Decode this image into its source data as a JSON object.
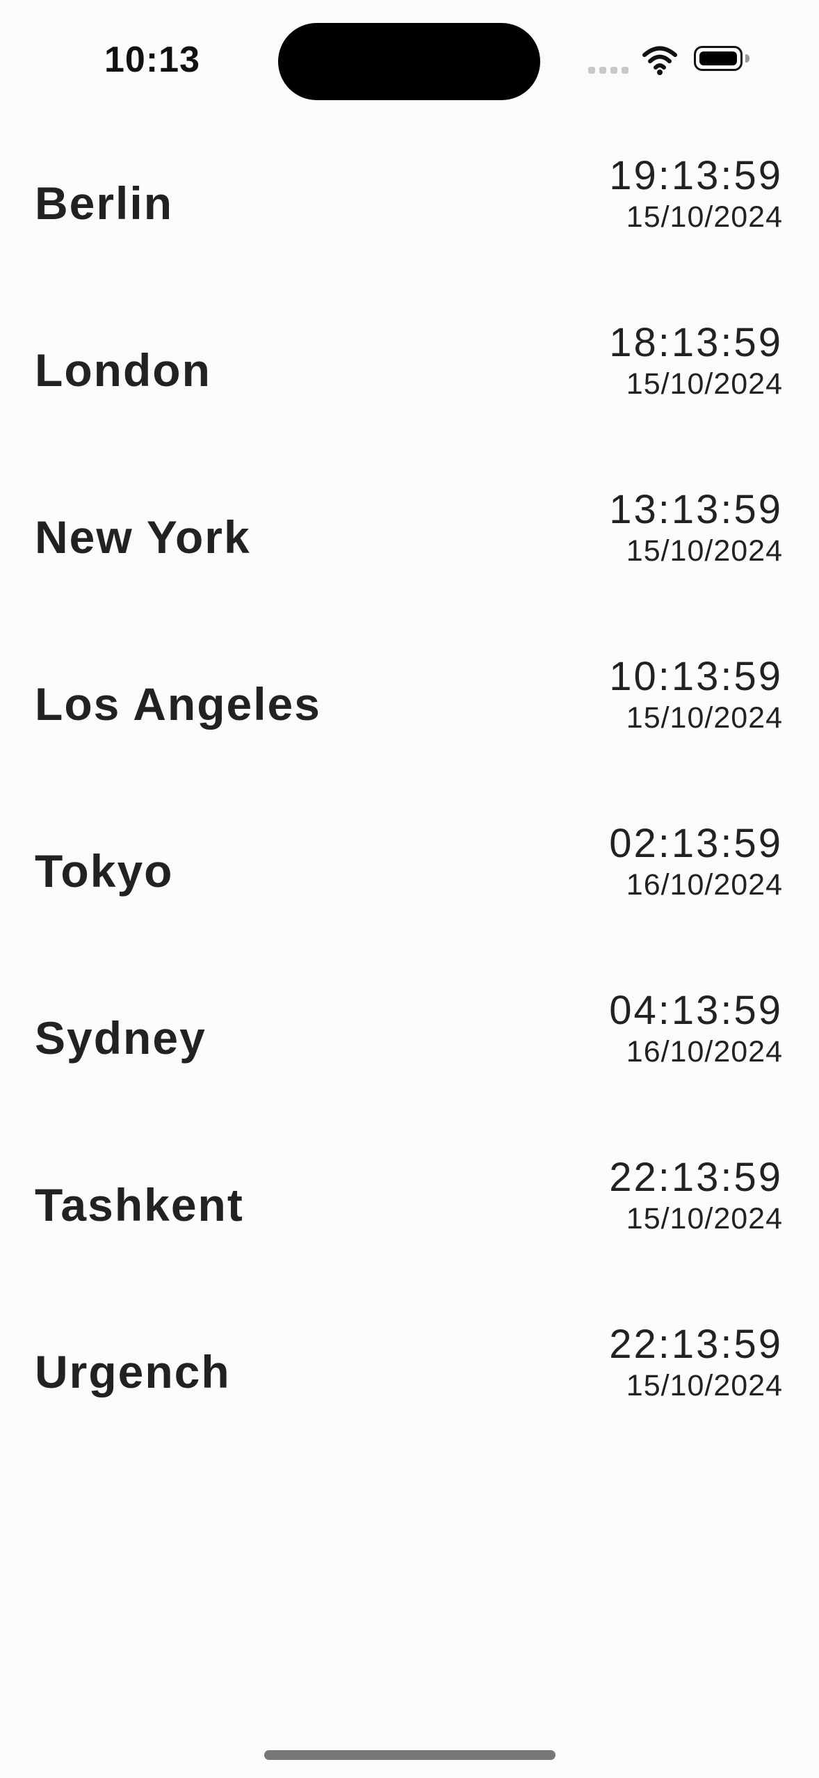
{
  "status_bar": {
    "time": "10:13",
    "signal_icon": "cellular-signal-icon",
    "wifi_icon": "wifi-icon",
    "battery_icon": "battery-icon"
  },
  "clocks": [
    {
      "city": "Berlin",
      "time": "19:13:59",
      "date": "15/10/2024"
    },
    {
      "city": "London",
      "time": "18:13:59",
      "date": "15/10/2024"
    },
    {
      "city": "New York",
      "time": "13:13:59",
      "date": "15/10/2024"
    },
    {
      "city": "Los Angeles",
      "time": "10:13:59",
      "date": "15/10/2024"
    },
    {
      "city": "Tokyo",
      "time": "02:13:59",
      "date": "16/10/2024"
    },
    {
      "city": "Sydney",
      "time": "04:13:59",
      "date": "16/10/2024"
    },
    {
      "city": "Tashkent",
      "time": "22:13:59",
      "date": "15/10/2024"
    },
    {
      "city": "Urgench",
      "time": "22:13:59",
      "date": "15/10/2024"
    }
  ],
  "colors": {
    "background": "#fbfbfa",
    "text": "#222222",
    "status_text": "#111111",
    "dynamic_island": "#000000"
  }
}
